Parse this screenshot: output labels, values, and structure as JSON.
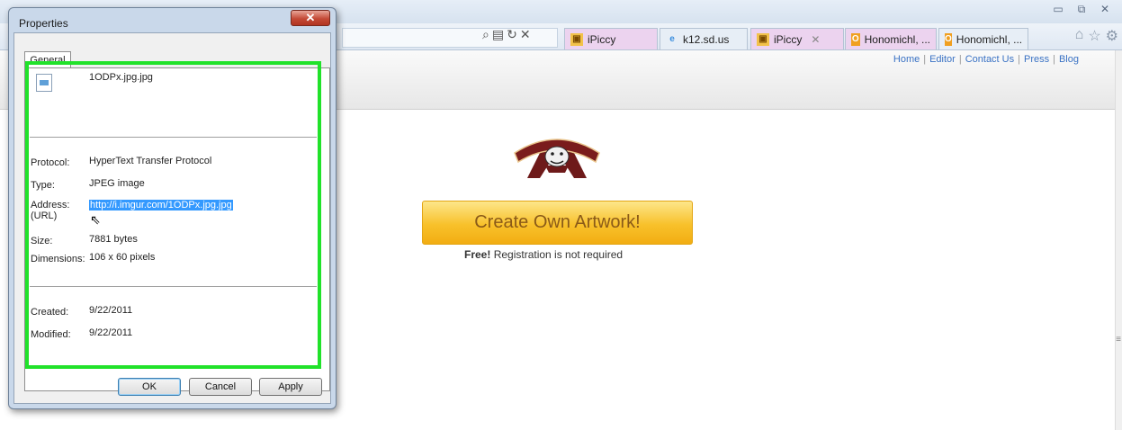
{
  "browser": {
    "tabs": [
      {
        "label": "iPiccy",
        "icon": "ipiccy-icon",
        "color": "#e6c4ea"
      },
      {
        "label": "k12.sd.us",
        "icon": "ie-icon",
        "color": "#dde6f0"
      },
      {
        "label": "iPiccy",
        "icon": "ipiccy-icon",
        "color": "#e6c4ea"
      },
      {
        "label": "Honomichl, ...",
        "icon": "orange-o-icon",
        "color": "#e6c4ea"
      },
      {
        "label": "Honomichl, ...",
        "icon": "orange-o-icon",
        "color": "#dde6f0"
      }
    ]
  },
  "site": {
    "links": [
      "Home",
      "Editor",
      "Contact Us",
      "Press",
      "Blog"
    ],
    "cta_label": "Create Own Artwork!",
    "free_bold": "Free!",
    "free_rest": "Registration is not required",
    "cta_color": "#f8c12b"
  },
  "dialog": {
    "title": "Properties",
    "tab": "General",
    "filename": "1ODPx.jpg.jpg",
    "labels": {
      "protocol": "Protocol:",
      "type": "Type:",
      "address": "Address:",
      "url": "(URL)",
      "size": "Size:",
      "dimensions": "Dimensions:",
      "created": "Created:",
      "modified": "Modified:"
    },
    "values": {
      "protocol": "HyperText Transfer Protocol",
      "type": "JPEG image",
      "address": "http://i.imgur.com/1ODPx.jpg.jpg",
      "size": "7881 bytes",
      "dimensions": "106  x  60 pixels",
      "created": "9/22/2011",
      "modified": "9/22/2011"
    },
    "buttons": {
      "ok": "OK",
      "cancel": "Cancel",
      "apply": "Apply"
    },
    "highlight_color": "#21e22a"
  }
}
